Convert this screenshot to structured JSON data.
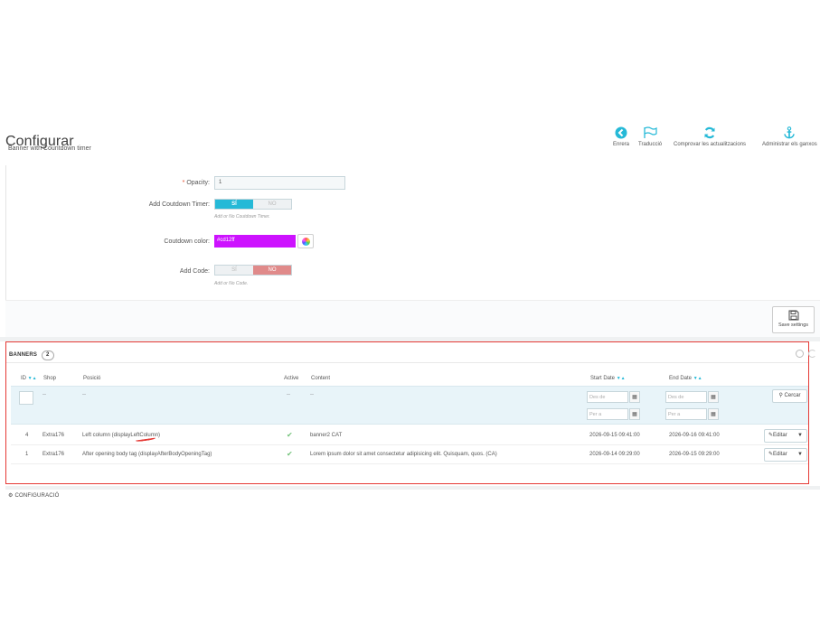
{
  "header": {
    "title": "Configurar",
    "subtitle": "Banner with Countdown timer"
  },
  "toolbar": {
    "back_label": "Enrera",
    "translate_label": "Traducció",
    "check_updates_label": "Comprovar les actualitzacions",
    "manage_hooks_label": "Administrar els ganxos"
  },
  "form": {
    "opacity_label": "Opacity:",
    "opacity_required_mark": "*",
    "opacity_value": "1",
    "countdown_label": "Add Coutdown Timer:",
    "countdown_yes": "SÍ",
    "countdown_no": "NO",
    "countdown_help": "Add or No Coutdown Timer.",
    "color_label": "Coutdown color:",
    "color_value": "#cd12ff",
    "code_label": "Add Code:",
    "code_yes": "SÍ",
    "code_no": "NO",
    "code_help": "Add or No Code.",
    "save_label": "Save settings"
  },
  "banners": {
    "title": "BANNERS",
    "count": "2",
    "columns": {
      "id": "ID",
      "shop": "Shop",
      "position": "Posició",
      "active": "Active",
      "content": "Content",
      "start_date": "Start Date",
      "end_date": "End Date"
    },
    "filters": {
      "dash": "--",
      "from_placeholder": "Des de",
      "to_placeholder": "Per a",
      "search_label": "Cercar"
    },
    "rows": [
      {
        "id": "4",
        "shop": "Extra176",
        "position": "Left column (displayLeftColumn)",
        "content": "banner2 CAT",
        "start": "2026-09-15 09:41:00",
        "end": "2026-09-16 09:41:00",
        "edit": "Editar"
      },
      {
        "id": "1",
        "shop": "Extra176",
        "position": "After opening body tag (displayAfterBodyOpeningTag)",
        "content": "Lorem ipsum dolor sit amet consectetur adipisicing elit. Quisquam, quos. (CA)",
        "start": "2026-09-14 09:29:00",
        "end": "2026-09-15 09:29:00",
        "edit": "Editar"
      }
    ]
  },
  "footer": {
    "config_label": "CONFIGURACIÓ"
  },
  "colors": {
    "accent": "#25b9d7",
    "no_active": "#e08a8a",
    "highlight_border": "#e53935",
    "swatch": "#cd12ff"
  },
  "icons": [
    "back-arrow-icon",
    "flag-icon",
    "refresh-icon",
    "anchor-icon",
    "save-icon",
    "search-icon",
    "pencil-icon",
    "calendar-icon",
    "check-icon",
    "gear-icon",
    "color-wheel-icon"
  ]
}
